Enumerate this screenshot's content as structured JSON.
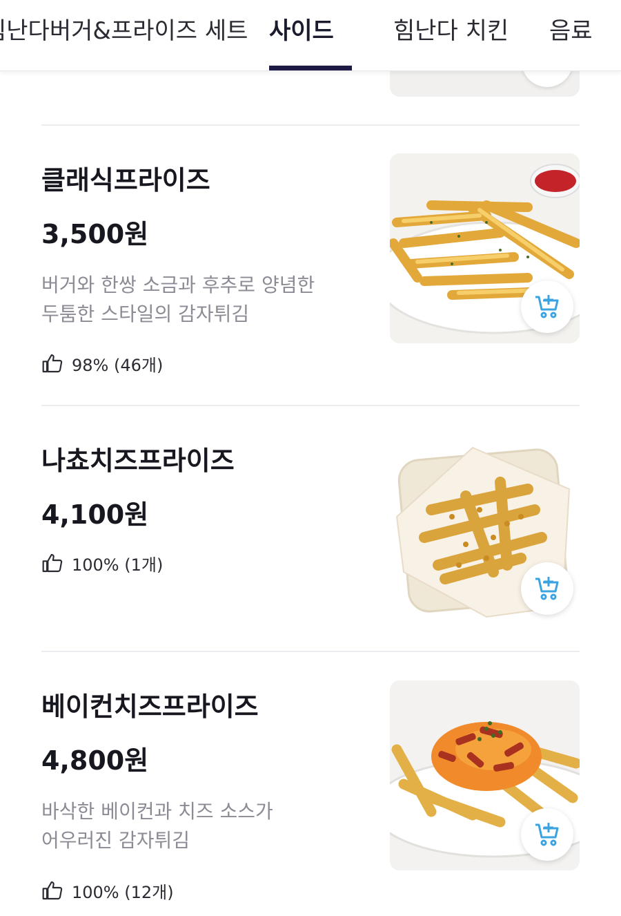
{
  "tabs": [
    {
      "label": "힘난다버거&프라이즈 세트"
    },
    {
      "label": "사이드",
      "active": true
    },
    {
      "label": "힘난다 치킨"
    },
    {
      "label": "음료"
    }
  ],
  "accent_color": "#1e1a46",
  "cart_icon_color": "#3ba3e0",
  "items": [
    {
      "name": "클래식프라이즈",
      "price": "3,500원",
      "desc_line1": "버거와 한쌍 소금과 후추로 양념한",
      "desc_line2": "두툼한 스타일의 감자튀김",
      "rating": "98% (46개)"
    },
    {
      "name": "나쵸치즈프라이즈",
      "price": "4,100원",
      "rating": "100% (1개)"
    },
    {
      "name": "베이컨치즈프라이즈",
      "price": "4,800원",
      "desc_line1": "바삭한 베이컨과 치즈 소스가",
      "desc_line2": "어우러진 감자튀김",
      "rating": "100% (12개)"
    }
  ]
}
